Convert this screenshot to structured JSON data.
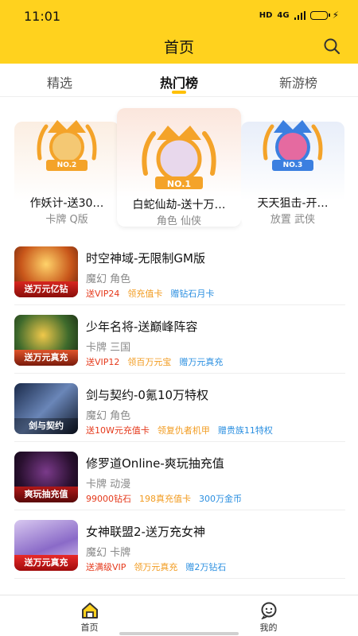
{
  "status": {
    "time": "11:01",
    "network": "HD",
    "signal": "4G"
  },
  "header": {
    "title": "首页"
  },
  "tabs": [
    {
      "label": "精选"
    },
    {
      "label": "热门榜"
    },
    {
      "label": "新游榜"
    }
  ],
  "podium": [
    {
      "rank_label": "NO.2",
      "title": "作妖计-送30…",
      "tags": "卡牌 Q版"
    },
    {
      "rank_label": "NO.1",
      "title": "白蛇仙劫-送十万…",
      "tags": "角色 仙侠"
    },
    {
      "rank_label": "NO.3",
      "title": "天天狙击-开…",
      "tags": "放置 武侠"
    }
  ],
  "games": [
    {
      "name": "时空神域-无限制GM版",
      "genre": "魔幻 角色",
      "banner": "送万元亿钻",
      "perks": [
        "送VIP24",
        "领充值卡",
        "赠钻石月卡"
      ]
    },
    {
      "name": "少年名将-送巅峰阵容",
      "genre": "卡牌 三国",
      "banner": "送万元真充",
      "perks": [
        "送VIP12",
        "领百万元宝",
        "赠万元真充"
      ]
    },
    {
      "name": "剑与契约-0氪10万特权",
      "genre": "魔幻 角色",
      "banner": "剑与契约",
      "perks": [
        "送10W元充值卡",
        "领复仇者机甲",
        "赠贵族11特权"
      ]
    },
    {
      "name": "修罗道Online-爽玩抽充值",
      "genre": "卡牌 动漫",
      "banner": "爽玩抽充值",
      "perks": [
        "99000钻石",
        "198真充值卡",
        "300万金币"
      ]
    },
    {
      "name": "女神联盟2-送万充女神",
      "genre": "魔幻 卡牌",
      "banner": "送万元真充",
      "perks": [
        "送满级VIP",
        "领万元真充",
        "赠2万钻石"
      ]
    }
  ],
  "bottom_nav": [
    {
      "label": "首页"
    },
    {
      "label": "我的"
    }
  ],
  "colors": {
    "brand": "#ffd21e",
    "perk_red": "#e5391b",
    "perk_orange": "#f29b1f",
    "perk_blue": "#2b8fe0"
  }
}
